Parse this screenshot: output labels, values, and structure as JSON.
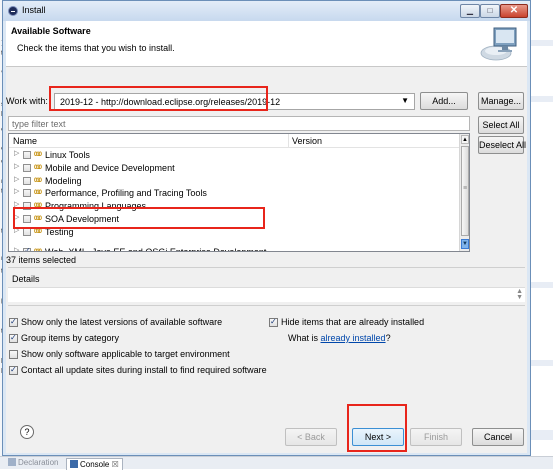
{
  "window": {
    "title": "Install",
    "minimize_glyph": "▁",
    "maximize_glyph": "□",
    "close_glyph": "✕"
  },
  "header": {
    "title": "Available Software",
    "description": "Check the items that you wish to install."
  },
  "work_with": {
    "label": "Work with:",
    "value": "2019-12 - http://download.eclipse.org/releases/2019-12",
    "add_button": "Add...",
    "manage_button": "Manage..."
  },
  "filter": {
    "placeholder": "type filter text"
  },
  "side_buttons": {
    "select_all": "Select All",
    "deselect_all": "Deselect All"
  },
  "tree": {
    "columns": [
      "Name",
      "Version"
    ],
    "rows": [
      {
        "label": "Linux Tools",
        "checked": false
      },
      {
        "label": "Mobile and Device Development",
        "checked": false
      },
      {
        "label": "Modeling",
        "checked": false
      },
      {
        "label": "Performance, Profiling and Tracing Tools",
        "checked": false
      },
      {
        "label": "Programming Languages",
        "checked": false
      },
      {
        "label": "SOA Development",
        "checked": false
      },
      {
        "label": "Testing",
        "checked": false
      },
      {
        "label": "Web, XML, Java EE and OSGi Enterprise Development",
        "checked": true
      }
    ]
  },
  "selection_count": "37 items selected",
  "details": {
    "label": "Details"
  },
  "options": {
    "latest_versions": "Show only the latest versions of available software",
    "hide_installed": "Hide items that are already installed",
    "group_by_category": "Group items by category",
    "what_is_prefix": "What is ",
    "already_installed_link": "already installed",
    "what_is_suffix": "?",
    "target_env": "Show only software applicable to target environment",
    "contact_sites": "Contact all update sites during install to find required software"
  },
  "footer": {
    "help": "?",
    "back": "< Back",
    "next": "Next >",
    "finish": "Finish",
    "cancel": "Cancel"
  },
  "background": {
    "tab_declaration": "Declaration",
    "tab_console": "Console",
    "tab_console_close": "☒",
    "left_glyphs": [
      "]",
      "t",
      "'",
      "s",
      "b",
      "e",
      "e",
      "c",
      "r",
      "t",
      "t",
      "n",
      "t",
      "p",
      "t",
      "b",
      "l"
    ]
  },
  "colors": {
    "highlight_red": "#e8251b",
    "accent_blue": "#3b8fd4",
    "link": "#0047ab"
  }
}
